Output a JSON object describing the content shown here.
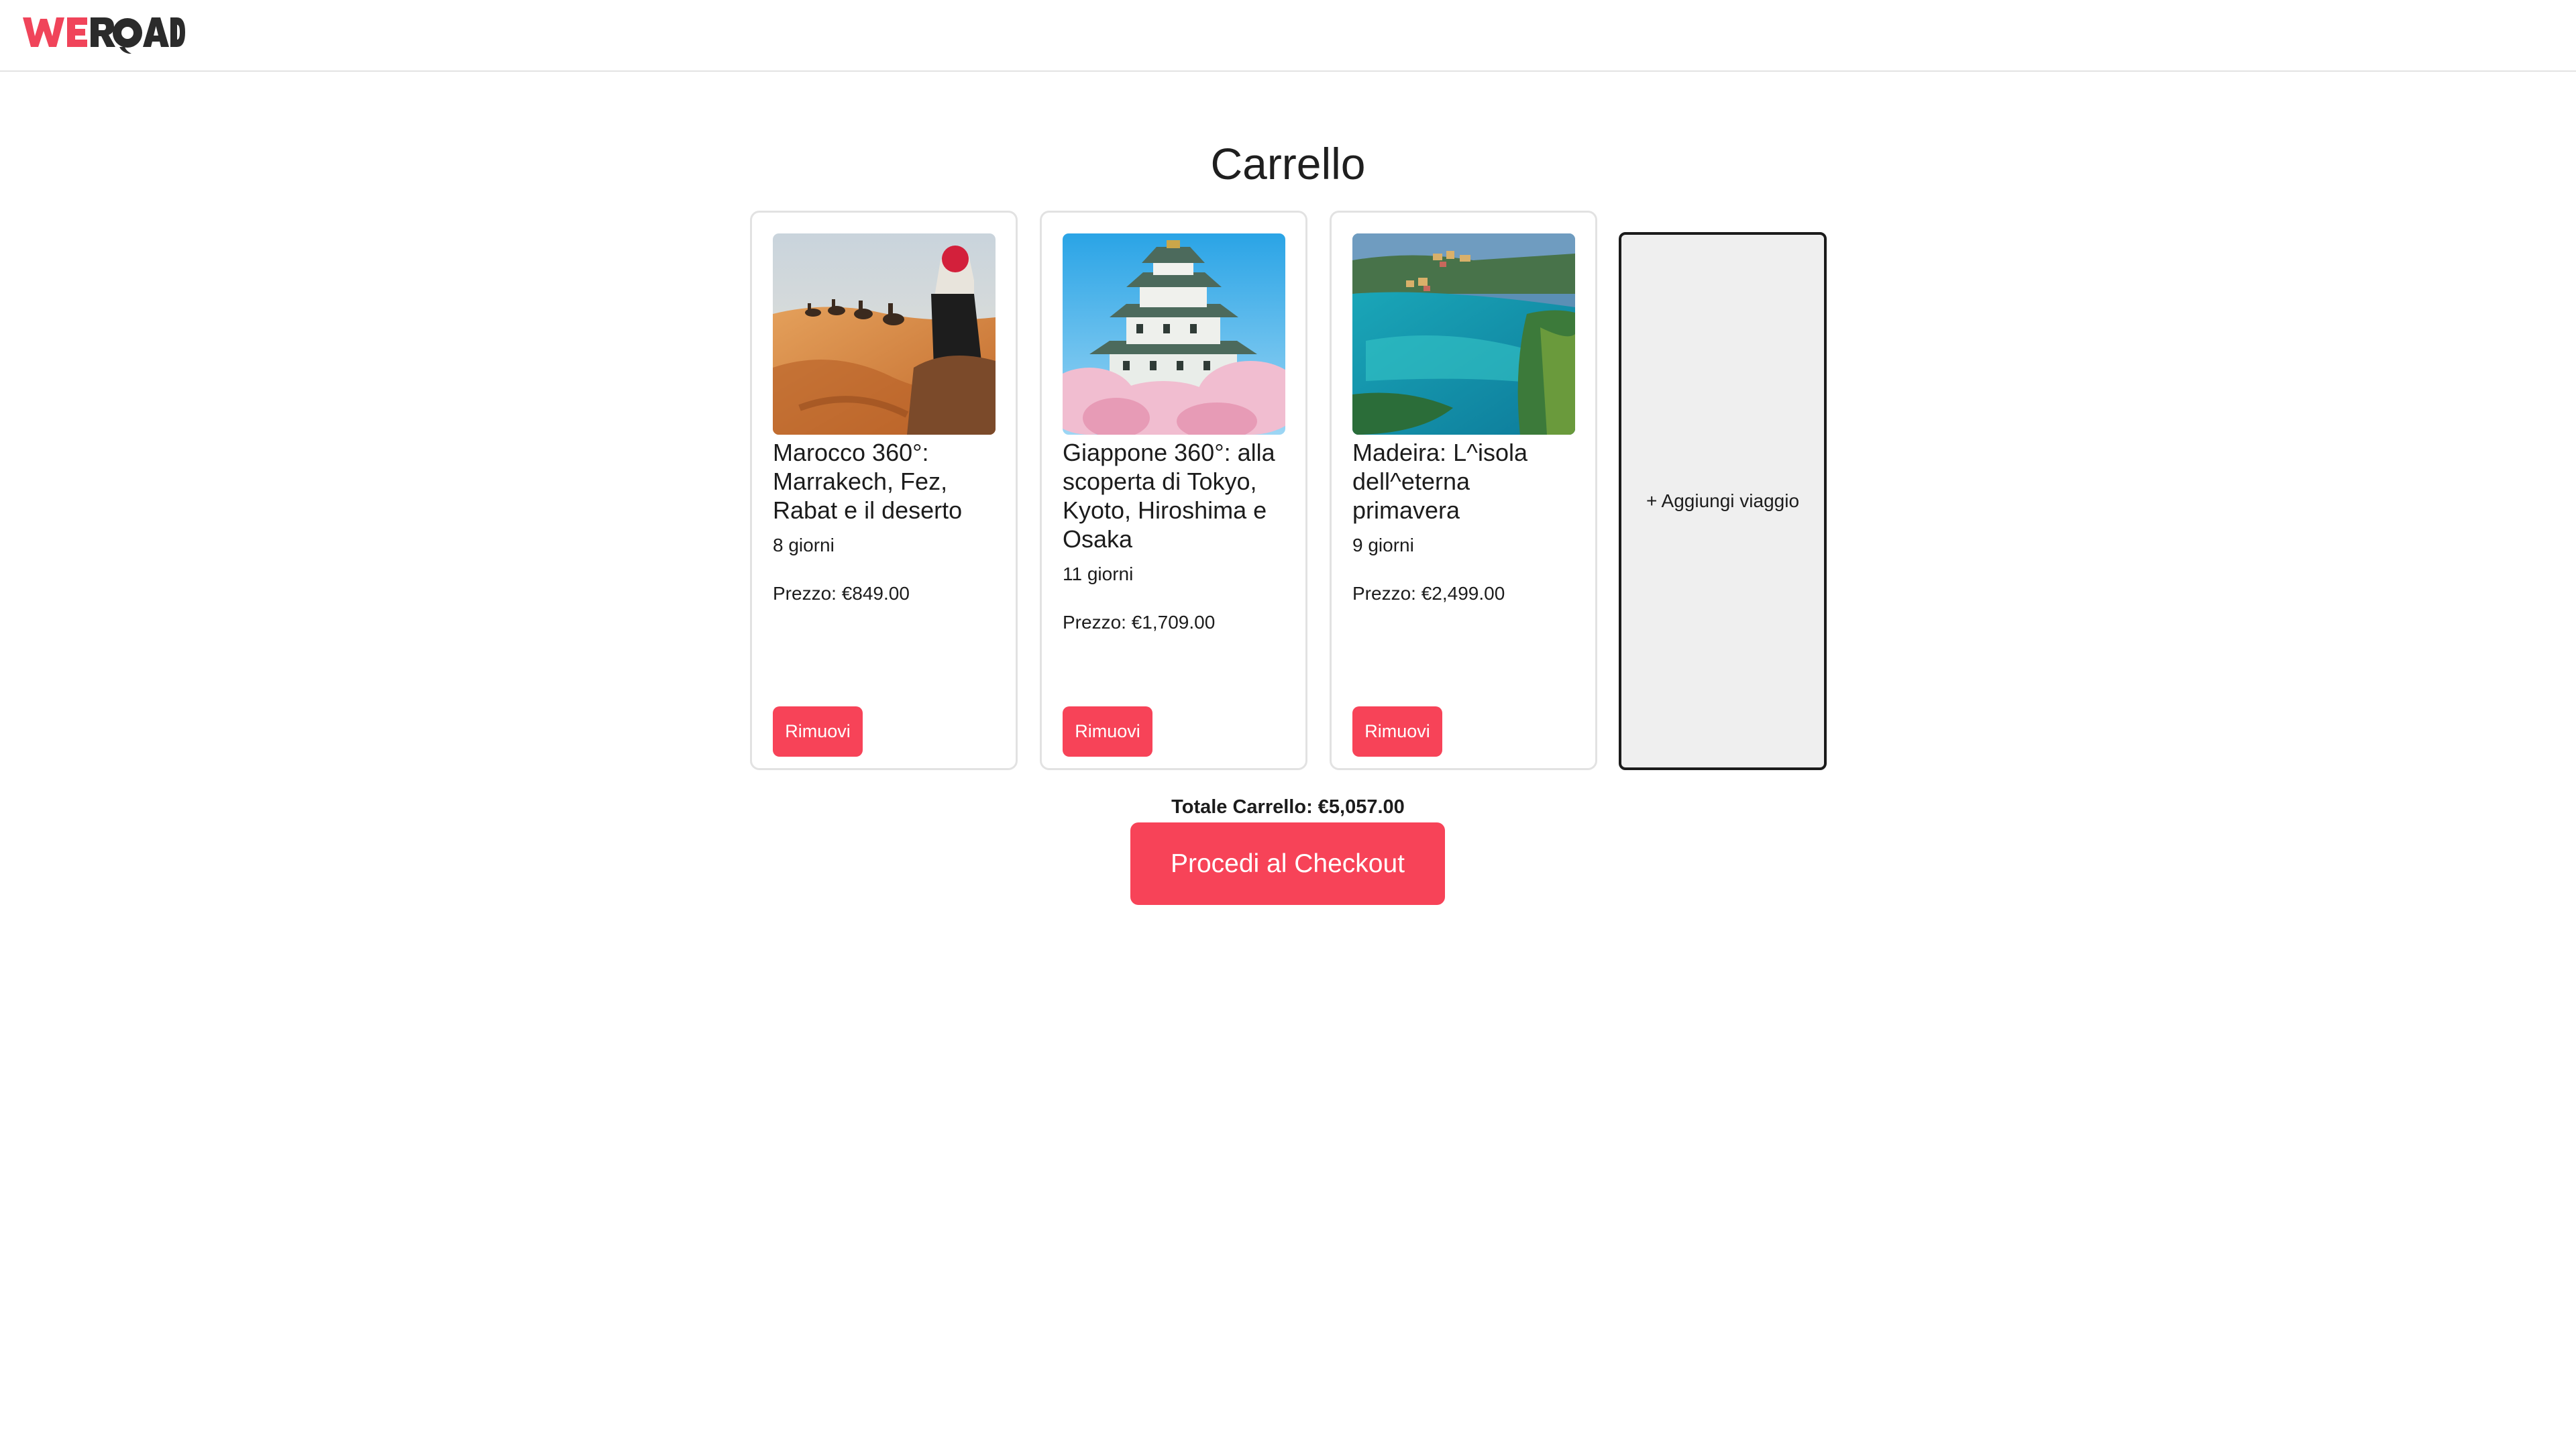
{
  "brand": {
    "name": "WEROAD",
    "colors": {
      "accent": "#f74358",
      "logo_red": "#f0445a",
      "logo_dark": "#2b2b2b"
    }
  },
  "page": {
    "title": "Carrello"
  },
  "cart": {
    "items": [
      {
        "title": "Marocco 360°: Marrakech, Fez, Rabat e il deserto",
        "days": "8 giorni",
        "price": "Prezzo: €849.00",
        "remove_label": "Rimuovi",
        "image_icon": "desert-camel-caravan-image"
      },
      {
        "title": "Giappone 360°: alla scoperta di Tokyo, Kyoto, Hiroshima e Osaka",
        "days": "11 giorni",
        "price": "Prezzo: €1,709.00",
        "remove_label": "Rimuovi",
        "image_icon": "japanese-castle-cherry-blossom-image"
      },
      {
        "title": "Madeira: L^isola dell^eterna primavera",
        "days": "9 giorni",
        "price": "Prezzo: €2,499.00",
        "remove_label": "Rimuovi",
        "image_icon": "coastal-bay-village-image"
      }
    ],
    "add_trip_label": "+ Aggiungi viaggio",
    "total_label": "Totale Carrello: €5,057.00",
    "checkout_label": "Procedi al Checkout"
  }
}
